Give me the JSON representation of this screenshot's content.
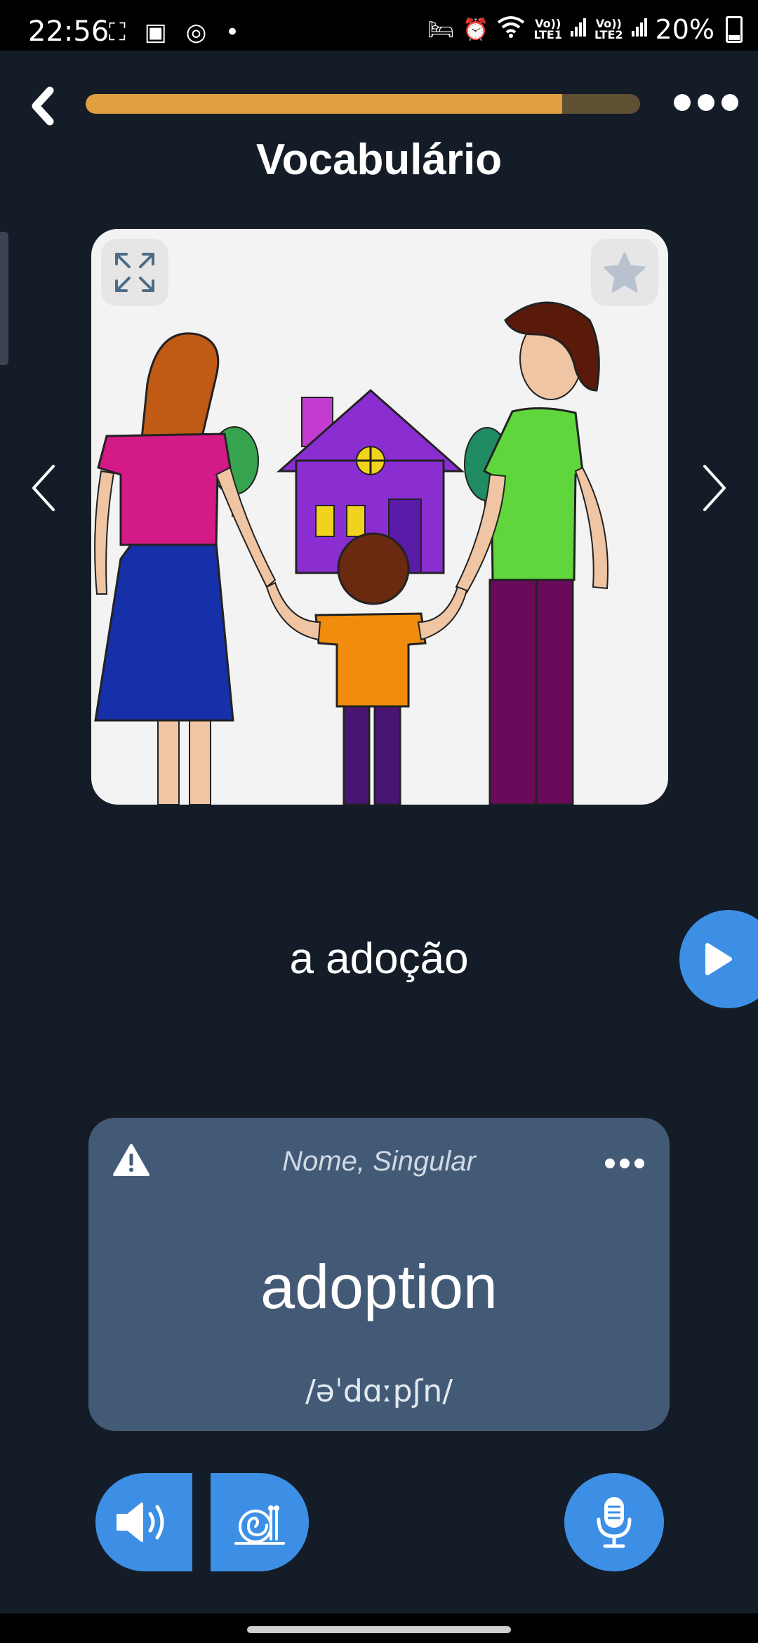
{
  "status_bar": {
    "time": "22:56",
    "left_icons": [
      "screenshot-frame-icon",
      "screen-record-icon",
      "app-icon",
      "dot-icon"
    ],
    "right_icons": [
      "sleep-icon",
      "alarm-icon",
      "wifi-icon",
      "signal-lte1-icon",
      "signal-lte2-icon"
    ],
    "lte1": "LTE1",
    "lte2": "LTE2",
    "volte": "Vo))",
    "battery": "20%"
  },
  "lesson": {
    "progress_fraction": 0.86,
    "progress_color": "#e0a041",
    "progress_track_color": "#5f5032",
    "title": "Vocabulário"
  },
  "card": {
    "image_subject": "family-adoption-illustration",
    "word": "a adoção"
  },
  "translation_card": {
    "tags": "Nome, Singular",
    "translation": "adoption",
    "phonetic": "/əˈdɑːpʃn/"
  },
  "colors": {
    "background": "#141c27",
    "accent_blue": "#3c8fe5",
    "card_bg": "#435a77"
  }
}
